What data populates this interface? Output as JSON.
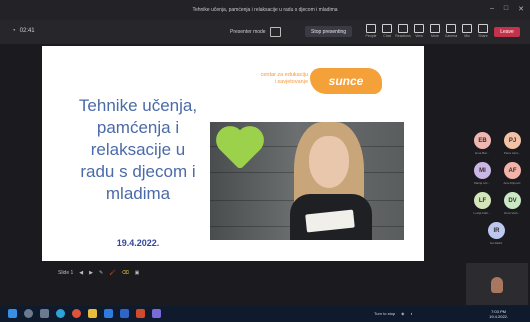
{
  "window": {
    "title": "Tehnike učenja, pamćenja i relaksacije u radu s djecom i mladima",
    "controls": [
      "–",
      "□",
      "✕"
    ]
  },
  "toolbar": {
    "timer": "02:41",
    "presenter_mode": "Presenter mode",
    "stop_presenting": "Stop presenting",
    "icons": [
      {
        "icon": "people-icon",
        "label": "People"
      },
      {
        "icon": "chat-icon",
        "label": "Chat"
      },
      {
        "icon": "raise-hand-icon",
        "label": "Reactions"
      },
      {
        "icon": "view-icon",
        "label": "View"
      },
      {
        "icon": "more-icon",
        "label": "More"
      },
      {
        "icon": "camera-icon",
        "label": "Camera"
      },
      {
        "icon": "mic-icon",
        "label": "Mic"
      },
      {
        "icon": "share-icon",
        "label": "Share"
      }
    ],
    "leave": "Leave"
  },
  "slide": {
    "title": "Tehnike učenja,\npamćenja i\nrelaksacije u\nradu s djecom i\nmladima",
    "date": "19.4.2022.",
    "org_text": "centar za edukaciju\ni savjetovanje",
    "org_logo": "sunce"
  },
  "presentation_controls": [
    "Slide 1",
    "◀",
    "▶",
    "✎",
    "🖌",
    "⌫",
    "▣"
  ],
  "participants": [
    {
      "initials": "EB",
      "name": "Ema Bal...",
      "color": "#f0b7b1"
    },
    {
      "initials": "PJ",
      "name": "Petra Jard...",
      "color": "#f1c2a6"
    },
    {
      "initials": "MI",
      "name": "Marija Ivić...",
      "color": "#c9b7e6"
    },
    {
      "initials": "AF",
      "name": "Ana Filipović",
      "color": "#f2b3a8"
    },
    {
      "initials": "LF",
      "name": "Lucija Fabi...",
      "color": "#d2e6ba"
    },
    {
      "initials": "DV",
      "name": "Dora Vlah...",
      "color": "#c9e8c4"
    },
    {
      "initials": "IR",
      "name": "Iva Radić",
      "color": "#bcc8ee"
    }
  ],
  "taskbar": {
    "apps": [
      {
        "icon": "windows-icon",
        "color": "#3a8ee6"
      },
      {
        "icon": "search-icon",
        "color": "#6c7a90"
      },
      {
        "icon": "task-view-icon",
        "color": "#6c7a90"
      },
      {
        "icon": "edge-icon",
        "color": "#2fa3d6"
      },
      {
        "icon": "chrome-icon",
        "color": "#e0533b"
      },
      {
        "icon": "files-icon",
        "color": "#e8bd3b"
      },
      {
        "icon": "outlook-icon",
        "color": "#2f7be0"
      },
      {
        "icon": "word-icon",
        "color": "#2f64c8"
      },
      {
        "icon": "powerpoint-icon",
        "color": "#d04a2b"
      },
      {
        "icon": "teams-icon",
        "color": "#7a6ad8"
      }
    ],
    "tray": "Turn to stop",
    "time": "7:03 PM",
    "date": "19.4.2022."
  }
}
